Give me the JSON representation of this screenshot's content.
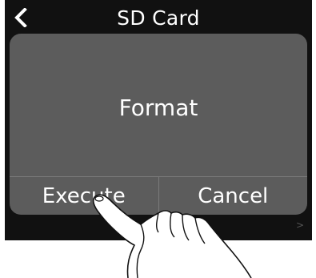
{
  "header": {
    "title": "SD Card",
    "back_icon": "chevron-left-icon"
  },
  "dialog": {
    "message": "Format",
    "buttons": [
      {
        "label": "Execute"
      },
      {
        "label": "Cancel"
      }
    ]
  },
  "footer": {
    "more_indicator": ">"
  }
}
